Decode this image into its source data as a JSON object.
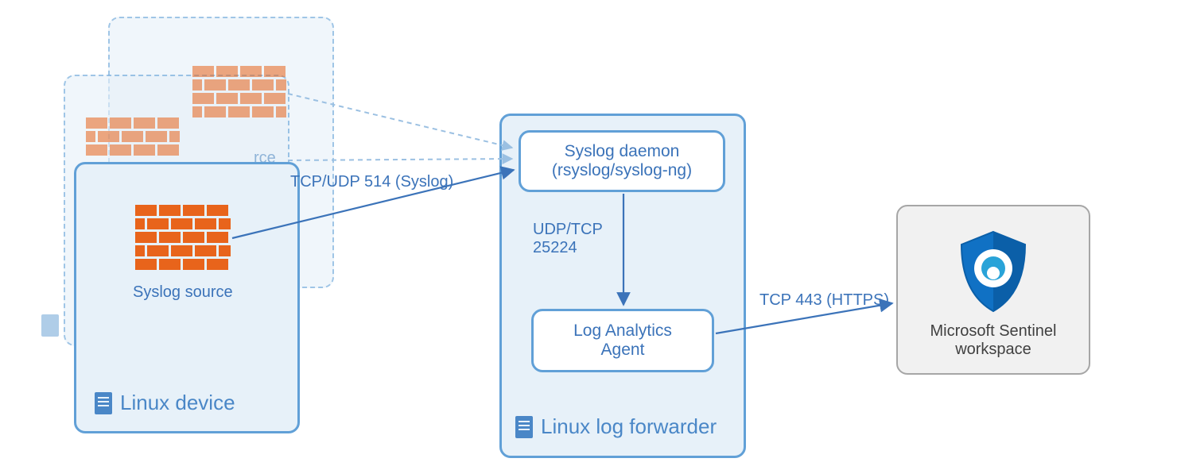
{
  "nodes": {
    "linux_device": {
      "title": "Linux device",
      "source_label": "Syslog source",
      "ghost_source_label": "rce",
      "ghost_source_label2": "e"
    },
    "forwarder": {
      "title": "Linux log forwarder",
      "syslog_daemon_line1": "Syslog daemon",
      "syslog_daemon_line2": "(rsyslog/syslog-ng)",
      "la_agent_line1": "Log Analytics",
      "la_agent_line2": "Agent"
    },
    "sentinel": {
      "line1": "Microsoft Sentinel",
      "line2": "workspace"
    }
  },
  "edges": {
    "src_to_daemon": "TCP/UDP 514 (Syslog)",
    "daemon_to_agent_line1": "UDP/TCP",
    "daemon_to_agent_line2": "25224",
    "agent_to_sentinel": "TCP 443 (HTTPS)"
  }
}
